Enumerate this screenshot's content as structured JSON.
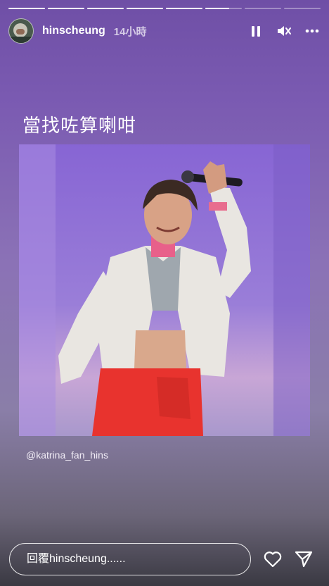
{
  "story": {
    "progress": [
      {
        "fill": 1
      },
      {
        "fill": 1
      },
      {
        "fill": 1
      },
      {
        "fill": 1
      },
      {
        "fill": 1
      },
      {
        "fill": 0.65
      },
      {
        "fill": 0
      },
      {
        "fill": 0
      }
    ]
  },
  "header": {
    "username": "hinscheung",
    "time": "14小時",
    "icons": [
      "pause-icon",
      "mute-icon",
      "more-icon"
    ]
  },
  "caption": "當找咗算喇咁",
  "photo": {
    "mention": "@katrina_fan_hins"
  },
  "footer": {
    "reply_placeholder": "回覆hinscheung......",
    "icons": [
      "heart-icon",
      "send-icon"
    ]
  },
  "colors": {
    "background_top": "#6f4fa6",
    "background_bottom": "#3a3942",
    "shorts_red": "#e8332e",
    "jacket_white": "#e9e6e1"
  }
}
